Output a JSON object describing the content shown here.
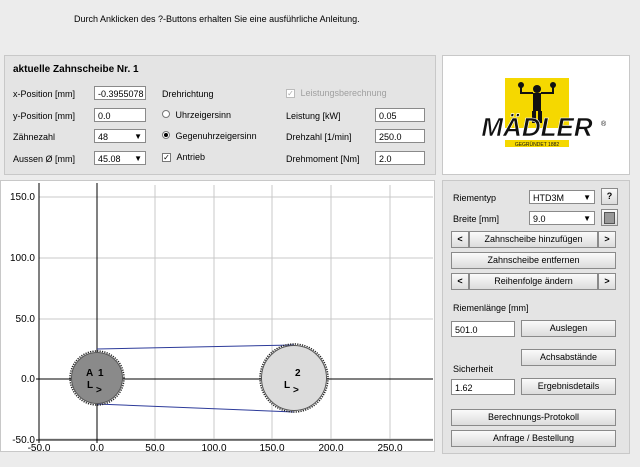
{
  "hint": "Durch Anklicken des ?-Buttons erhalten Sie eine ausführliche Anleitung.",
  "pulley_panel": {
    "title": "aktuelle Zahnscheibe Nr.  1",
    "x_label": "x-Position [mm]",
    "x_value": "-0.3955078",
    "y_label": "y-Position [mm]",
    "y_value": "0.0",
    "teeth_label": "Zähnezahl",
    "teeth_value": "48",
    "outer_label": "Aussen Ø [mm]",
    "outer_value": "45.08",
    "rotation_label": "Drehrichtung",
    "cw_label": "Uhrzeigersinn",
    "ccw_label": "Gegenuhrzeigersinn",
    "drive_label": "Antrieb",
    "calc_label": "Leistungsberechnung",
    "power_label": "Leistung [kW]",
    "power_value": "0.05",
    "speed_label": "Drehzahl [1/min]",
    "speed_value": "250.0",
    "torque_label": "Drehmoment [Nm]",
    "torque_value": "2.0"
  },
  "logo": {
    "brand": "MÄDLER",
    "tagline": "GEGRÜNDET 1882"
  },
  "right_panel": {
    "belt_type_label": "Riementyp",
    "belt_type_value": "HTD3M",
    "help_label": "?",
    "width_label": "Breite [mm]",
    "width_value": "9.0",
    "prev_label": "<",
    "next_label": ">",
    "add_pulley": "Zahnscheibe hinzufügen",
    "remove_pulley": "Zahnscheibe entfernen",
    "change_order": "Reihenfolge ändern",
    "belt_length_label": "Riemenlänge [mm]",
    "belt_length_value": "501.0",
    "design_button": "Auslegen",
    "center_distances_button": "Achsabstände",
    "safety_label": "Sicherheit",
    "safety_value": "1.62",
    "results_button": "Ergebnisdetails",
    "protocol_button": "Berechnungs-Protokoll",
    "order_button": "Anfrage / Bestellung"
  },
  "plot": {
    "x_ticks": [
      "-50.0",
      "0.0",
      "50.0",
      "100.0",
      "150.0",
      "200.0",
      "250.0"
    ],
    "y_ticks": [
      "150.0",
      "100.0",
      "50.0",
      "0.0",
      "-50.0"
    ],
    "pulley_1": {
      "number": "1",
      "letter_a": "A",
      "letter_l": "L",
      "arrow": ">"
    },
    "pulley_2": {
      "number": "2",
      "letter_l": "L",
      "arrow": ">"
    },
    "colors": {
      "pulley_1": "#8a8a8a",
      "pulley_2": "#dcdcdc",
      "belt": "#2d3b9a",
      "axis": "#000000"
    }
  }
}
